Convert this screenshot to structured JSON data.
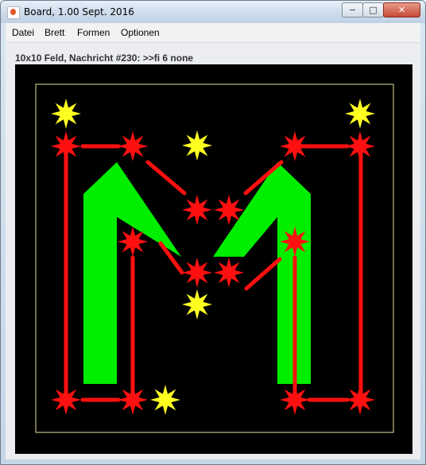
{
  "window": {
    "title": "Board, 1.00 Sept. 2016",
    "min_glyph": "−",
    "max_glyph": "□",
    "close_glyph": "✕"
  },
  "menu": {
    "items": [
      "Datei",
      "Brett",
      "Formen",
      "Optionen"
    ]
  },
  "status": {
    "text": "10x10 Feld, Nachricht #230: >>fi 6 none"
  },
  "board": {
    "background": "#000000",
    "frame_color": "#e8e0a0",
    "letter": "M",
    "letter_color": "#00ee00",
    "link_color": "#ff1010",
    "star_red": "#ff1010",
    "star_yellow": "#ffff20"
  }
}
